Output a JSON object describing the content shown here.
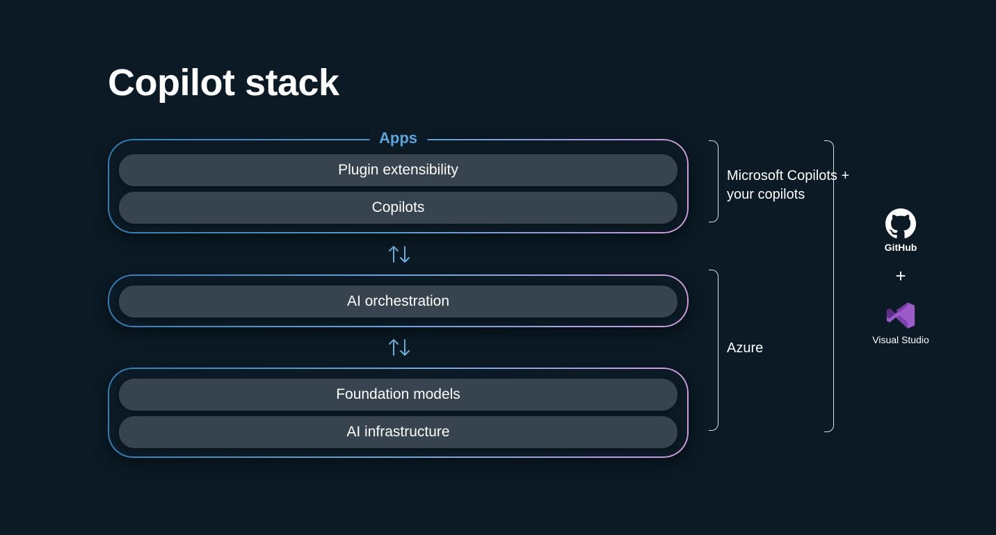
{
  "title": "Copilot stack",
  "groups": {
    "apps": {
      "label": "Apps",
      "items": [
        "Plugin extensibility",
        "Copilots"
      ]
    },
    "orchestration": {
      "items": [
        "AI orchestration"
      ]
    },
    "foundation": {
      "items": [
        "Foundation models",
        "AI infrastructure"
      ]
    }
  },
  "right": {
    "copilots_label": "Microsoft Copilots + your copilots",
    "azure_label": "Azure"
  },
  "tools": {
    "github": "GitHub",
    "plus": "+",
    "visual_studio": "Visual Studio"
  }
}
